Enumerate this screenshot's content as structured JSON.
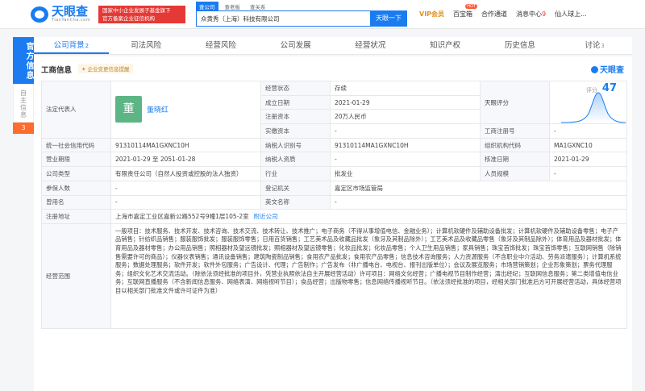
{
  "header": {
    "logo_name": "天眼查",
    "logo_url": "TianYanCha.com",
    "promo_line1": "国家中小企业发展子基金旗下",
    "promo_line2": "官方备案企业征信机构",
    "search_tabs": [
      "查公司",
      "查老板",
      "查关系"
    ],
    "search_value": "众黄秀（上海）科技有限公司",
    "search_button": "天眼一下",
    "nav": {
      "vip": "VIP会员",
      "treasure": "百宝箱",
      "hot": "HOT",
      "cooperation": "合作通道",
      "messages": "消息中心",
      "messages_count": "9",
      "user": "仙人球上..."
    }
  },
  "sidebar": {
    "active": "官方信息",
    "item": "自主信息",
    "item_badge": "3"
  },
  "tabs": [
    {
      "label": "公司背景",
      "count": "2"
    },
    {
      "label": "司法风险",
      "count": ""
    },
    {
      "label": "经营风险",
      "count": ""
    },
    {
      "label": "公司发展",
      "count": ""
    },
    {
      "label": "经营状况",
      "count": ""
    },
    {
      "label": "知识产权",
      "count": ""
    },
    {
      "label": "历史信息",
      "count": ""
    },
    {
      "label": "讨论",
      "count": "3"
    }
  ],
  "section": {
    "title": "工商信息",
    "hint": "✦ 企业变更信息提醒",
    "brand": "天眼查"
  },
  "info": {
    "legal_rep_label": "法定代表人",
    "avatar_char": "董",
    "legal_rep": "董晓红",
    "status_label": "经营状态",
    "status": "存续",
    "founded_label": "成立日期",
    "founded": "2021-01-29",
    "score_label": "天眼评分",
    "score_title": "评分",
    "score": "47",
    "capital_label": "注册资本",
    "capital": "20万人民币",
    "paid_label": "实缴资本",
    "paid": "-",
    "reg_no_label": "工商注册号",
    "reg_no": "-",
    "credit_label": "统一社会信用代码",
    "credit": "91310114MA1GXNC10H",
    "taxid_label": "纳税人识别号",
    "taxid": "91310114MA1GXNC10H",
    "org_code_label": "组织机构代码",
    "org_code": "MA1GXNC10",
    "term_label": "营业期限",
    "term": "2021-01-29 至 2051-01-28",
    "taxpayer_label": "纳税人资质",
    "taxpayer": "-",
    "approve_label": "核准日期",
    "approve": "2021-01-29",
    "type_label": "公司类型",
    "type": "有限责任公司（自然人投资或控股的法人独资）",
    "industry_label": "行业",
    "industry": "批发业",
    "staff_label": "人员规模",
    "staff": "-",
    "insured_label": "参保人数",
    "insured": "-",
    "authority_label": "登记机关",
    "authority": "嘉定区市场监管局",
    "former_label": "曾用名",
    "former": "-",
    "en_label": "英文名称",
    "en": "-",
    "address_label": "注册地址",
    "address": "上海市嘉定工业区嘉新公路552号9幢1层105-2室",
    "address_link": "附近公司",
    "scope_label": "经营范围",
    "scope": "一般项目：技术服务、技术开发、技术咨询、技术交流、技术转让、技术推广；电子商务（不得从事增值电信、金融业务）；计算机软硬件及辅助设备批发；计算机软硬件及辅助设备零售；电子产品销售；针纺织品销售；服装服饰批发；服装服饰零售；日用百货销售；工艺美术品及收藏品批发（象牙及其制品除外）；工艺美术品及收藏品零售（象牙及其制品除外）；体育用品及器材批发；体育用品及器材零售；办公用品销售；照相器材及望远镜批发；照相器材及望远镜零售；化妆品批发；化妆品零售；个人卫生用品销售；家具销售；珠宝首饰批发；珠宝首饰零售；互联网销售（除销售需要许可的商品）；仪器仪表销售；通讯设备销售；建筑陶瓷制品销售；食用农产品批发；食用农产品零售；信息技术咨询服务；人力资源服务（不含职业中介活动、劳务派遣服务）；计算机系统服务；数据处理服务；软件开发；软件外包服务；广告设计、代理；广告制作；广告发布（非广播电台、电视台、报刊出版单位）；会议及展览服务；市场营销策划；企业形象策划；票务代理服务；组织文化艺术交流活动。（除依法须经批准的项目外，凭营业执照依法自主开展经营活动）许可项目：网络文化经营；广播电视节目制作经营；演出经纪；互联网信息服务；第二类增值电信业务；互联网直播服务（不含新闻信息服务、网络表演、网络视听节目）；食品经营；出版物零售；信息网络传播视听节目。（依法须经批准的项目，经相关部门批准后方可开展经营活动，具体经营项目以相关部门批准文件或许可证件为准）"
  },
  "colors": {
    "accent": "#1a7cf0",
    "vip": "#e0901a",
    "promo": "#e53935",
    "avatar": "#5db585"
  }
}
